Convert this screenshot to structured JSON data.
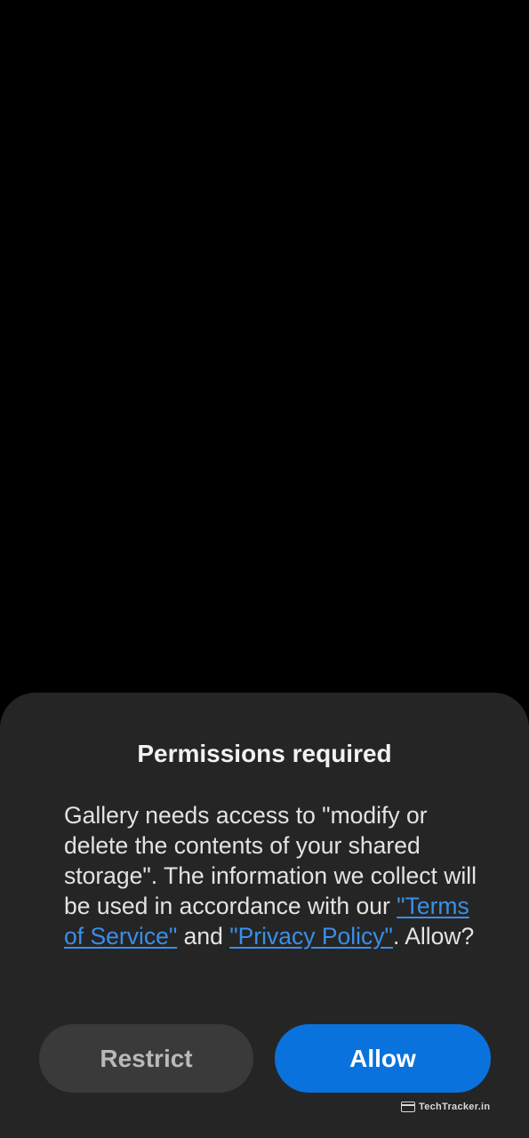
{
  "dialog": {
    "title": "Permissions required",
    "message_intro": "Gallery needs access to \"modify or delete the contents of your shared storage\". The information we collect will be used in accordance with our ",
    "terms_link": "\"Terms of Service\"",
    "message_and": " and ",
    "privacy_link": "\"Privacy Policy\"",
    "message_outro": ". Allow?",
    "restrict_label": "Restrict",
    "allow_label": "Allow"
  },
  "watermark": {
    "text": "TechTracker.in",
    "icon": "browser-window-icon"
  },
  "colors": {
    "background": "#000000",
    "sheet": "#252525",
    "link": "#3a8fe8",
    "allow_button": "#0a72dd",
    "restrict_button": "#3a3a3a"
  }
}
